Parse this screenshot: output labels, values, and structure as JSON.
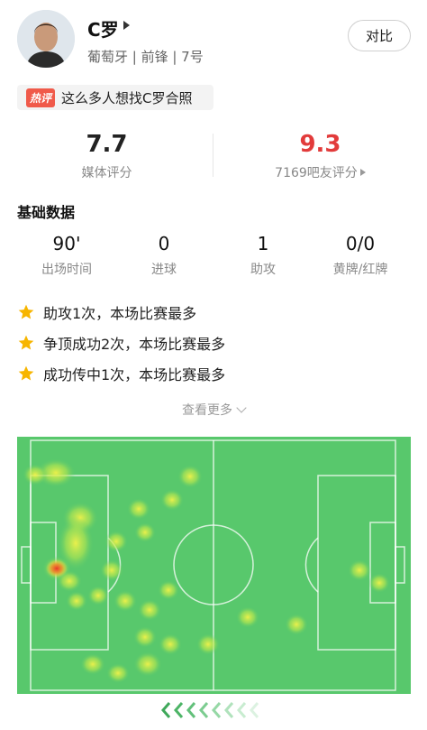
{
  "player": {
    "name": "C罗",
    "meta": "葡萄牙 | 前锋 | 7号",
    "compare_label": "对比"
  },
  "hot": {
    "tag": "热评",
    "text": "这么多人想找C罗合照"
  },
  "ratings": {
    "media_value": "7.7",
    "media_label": "媒体评分",
    "fan_value": "9.3",
    "fan_label": "7169吧友评分"
  },
  "basic": {
    "title": "基础数据",
    "stats": [
      {
        "value": "90'",
        "label": "出场时间"
      },
      {
        "value": "0",
        "label": "进球"
      },
      {
        "value": "1",
        "label": "助攻"
      },
      {
        "value": "0/0",
        "label": "黄牌/红牌"
      }
    ]
  },
  "highlights": [
    "助攻1次，本场比赛最多",
    "争顶成功2次，本场比赛最多",
    "成功传中1次，本场比赛最多"
  ],
  "more_label": "查看更多",
  "colors": {
    "fan_rating": "#e23b3b",
    "pitch": "#58c86c",
    "star": "#f7b500",
    "hot_tag": "#f05a4a"
  }
}
